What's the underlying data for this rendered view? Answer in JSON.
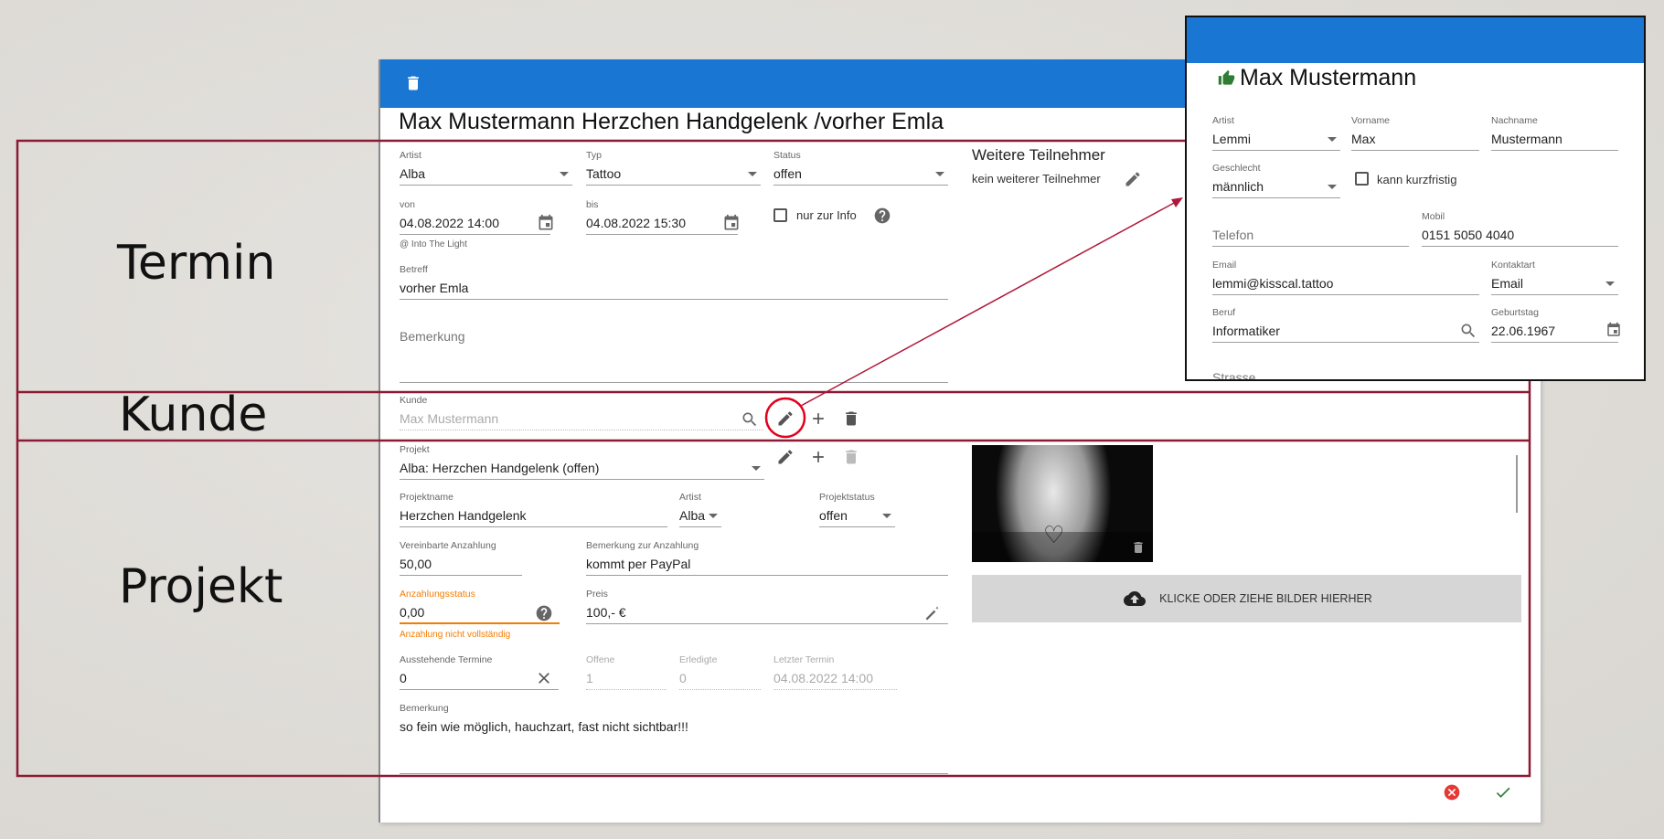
{
  "annotations": {
    "termin": "Termin",
    "kunde": "Kunde",
    "projekt": "Projekt",
    "accent_color": "#8b1a34",
    "highlight_color": "#e3001b"
  },
  "appointment": {
    "title": "Max Mustermann Herzchen Handgelenk /vorher Emla",
    "header_color": "#1976d2",
    "artist": {
      "label": "Artist",
      "value": "Alba"
    },
    "type": {
      "label": "Typ",
      "value": "Tattoo"
    },
    "status": {
      "label": "Status",
      "value": "offen"
    },
    "from": {
      "label": "von",
      "value": "04.08.2022 14:00",
      "hint": "@ Into The Light"
    },
    "to": {
      "label": "bis",
      "value": "04.08.2022 15:30"
    },
    "info_only": {
      "label": "nur zur Info",
      "checked": false
    },
    "subject": {
      "label": "Betreff",
      "value": "vorher Emla"
    },
    "remark": {
      "placeholder": "Bemerkung"
    },
    "participants": {
      "title": "Weitere Teilnehmer",
      "value": "kein weiterer Teilnehmer"
    }
  },
  "customer": {
    "label": "Kunde",
    "value": "Max Mustermann"
  },
  "project": {
    "select": {
      "label": "Projekt",
      "value": "Alba: Herzchen Handgelenk (offen)"
    },
    "name": {
      "label": "Projektname",
      "value": "Herzchen Handgelenk"
    },
    "artist": {
      "label": "Artist",
      "value": "Alba"
    },
    "status": {
      "label": "Projektstatus",
      "value": "offen"
    },
    "deposit": {
      "label": "Vereinbarte Anzahlung",
      "value": "50,00"
    },
    "deposit_note": {
      "label": "Bemerkung zur Anzahlung",
      "value": "kommt per PayPal"
    },
    "deposit_status": {
      "label": "Anzahlungsstatus",
      "value": "0,00",
      "error": "Anzahlung nicht vollständig",
      "color": "#f57c00"
    },
    "price": {
      "label": "Preis",
      "value": "100,- €"
    },
    "pending": {
      "label": "Ausstehende Termine",
      "value": "0"
    },
    "open": {
      "label": "Offene",
      "value": "1"
    },
    "done": {
      "label": "Erledigte",
      "value": "0"
    },
    "last": {
      "label": "Letzter Termin",
      "value": "04.08.2022 14:00"
    },
    "remark": {
      "label": "Bemerkung",
      "value": "so fein wie möglich, hauchzart, fast nicht sichtbar!!!"
    },
    "upload_label": "KLICKE ODER ZIEHE BILDER HIERHER"
  },
  "customer_dialog": {
    "name": "Max Mustermann",
    "artist": {
      "label": "Artist",
      "value": "Lemmi"
    },
    "first_name": {
      "label": "Vorname",
      "value": "Max"
    },
    "last_name": {
      "label": "Nachname",
      "value": "Mustermann"
    },
    "gender": {
      "label": "Geschlecht",
      "value": "männlich"
    },
    "short_notice": {
      "label": "kann kurzfristig",
      "checked": false
    },
    "phone": {
      "placeholder": "Telefon"
    },
    "mobile": {
      "label": "Mobil",
      "value": "0151 5050 4040"
    },
    "email": {
      "label": "Email",
      "value": "lemmi@kisscal.tattoo"
    },
    "contact_type": {
      "label": "Kontaktart",
      "value": "Email"
    },
    "job": {
      "label": "Beruf",
      "value": "Informatiker"
    },
    "birthday": {
      "label": "Geburtstag",
      "value": "22.06.1967"
    },
    "street": {
      "placeholder": "Strasse"
    }
  }
}
